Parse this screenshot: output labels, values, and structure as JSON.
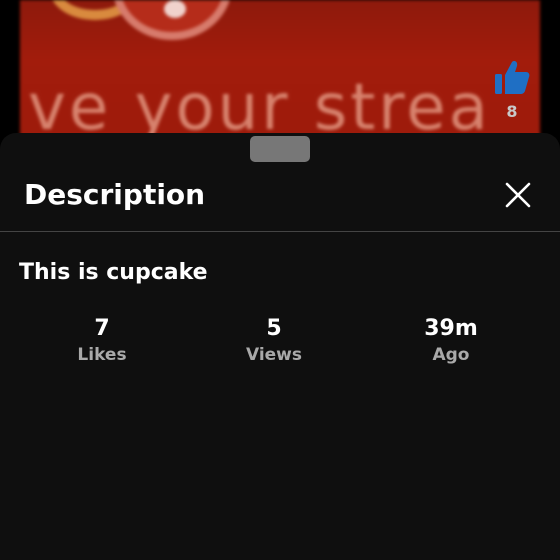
{
  "video": {
    "overlay_text": "ve your strea",
    "like_count": "8",
    "like_icon": "thumbs-up-icon",
    "colors": {
      "background": "#a21c0c",
      "text": "#d7826d",
      "like_icon": "#1f6fc4"
    }
  },
  "sheet": {
    "title": "Description",
    "close_icon": "close-icon",
    "description": "This is cupcake",
    "stats": [
      {
        "value": "7",
        "label": "Likes"
      },
      {
        "value": "5",
        "label": "Views"
      },
      {
        "value": "39m",
        "label": "Ago"
      }
    ],
    "colors": {
      "background": "#0f0f0f",
      "handle": "#777777",
      "label": "#a9a9a9"
    }
  }
}
